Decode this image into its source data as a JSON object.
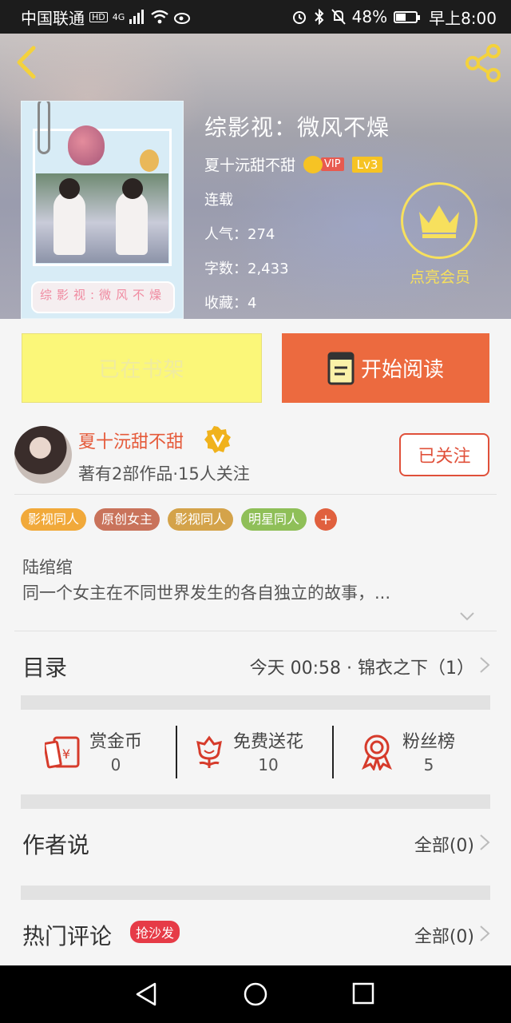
{
  "status_bar": {
    "carrier": "中国联通",
    "hd": "HD",
    "network": "4G",
    "battery": "48%",
    "battery_level": 0.48,
    "time": "早上8:00"
  },
  "hero": {
    "book_title": "综影视：微风不燥",
    "author": "夏十沅甜不甜",
    "vip_label": "VIP",
    "level": "Lv3",
    "status": "连载",
    "popularity": "人气：274",
    "word_count": "字数：2,433",
    "favorites": "收藏：4",
    "cover_title": "综影视:微风不燥",
    "vip_cta": "点亮会员"
  },
  "actions": {
    "shelf_label": "已在书架",
    "read_label": "开始阅读"
  },
  "author_card": {
    "name": "夏十沅甜不甜",
    "stats": "著有2部作品·15人关注",
    "follow_label": "已关注"
  },
  "tags": [
    {
      "label": "影视同人",
      "color": "#f1a93a"
    },
    {
      "label": "原创女主",
      "color": "#c9735b"
    },
    {
      "label": "影视同人",
      "color": "#d4a34a"
    },
    {
      "label": "明星同人",
      "color": "#8fbf58"
    }
  ],
  "tag_more": "+",
  "intro": {
    "line1": "陆绾绾",
    "line2": "同一个女主在不同世界发生的各自独立的故事，..."
  },
  "catalog": {
    "title": "目录",
    "latest": "今天 00:58 · 锦衣之下（1）"
  },
  "stats": [
    {
      "label": "赏金币",
      "value": "0",
      "icon": "reward-coin-icon"
    },
    {
      "label": "免费送花",
      "value": "10",
      "icon": "flower-icon"
    },
    {
      "label": "粉丝榜",
      "value": "5",
      "icon": "ribbon-medal-icon"
    }
  ],
  "author_say": {
    "title": "作者说",
    "all": "全部(0)"
  },
  "hot_comments": {
    "title": "热门评论",
    "badge": "抢沙发",
    "all": "全部(0)"
  },
  "colors": {
    "accent_orange": "#ec6a3f",
    "shelf_yellow": "#fbf779",
    "vip_gold": "#f7e05d",
    "author_red": "#e55a3a"
  }
}
